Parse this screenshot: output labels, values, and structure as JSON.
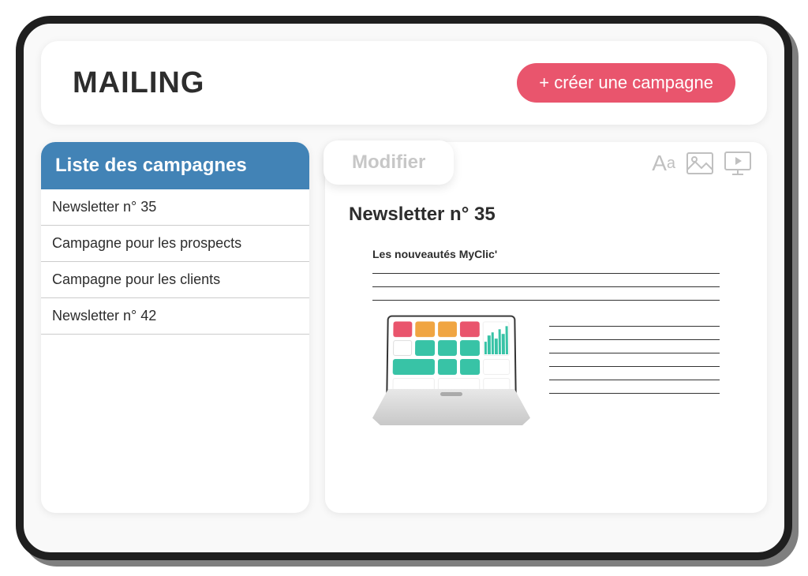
{
  "header": {
    "title": "MAILING",
    "create_button_label": "+ créer une campagne"
  },
  "sidebar": {
    "header": "Liste des campagnes",
    "items": [
      {
        "label": "Newsletter n° 35"
      },
      {
        "label": "Campagne pour les prospects"
      },
      {
        "label": "Campagne pour les clients"
      },
      {
        "label": "Newsletter n° 42"
      }
    ]
  },
  "editor": {
    "tab_label": "Modifier",
    "document_title": "Newsletter n° 35",
    "section_heading": "Les nouveautés MyClic'",
    "tools": {
      "text": "Aa",
      "image": "image-icon",
      "video": "video-icon"
    }
  }
}
